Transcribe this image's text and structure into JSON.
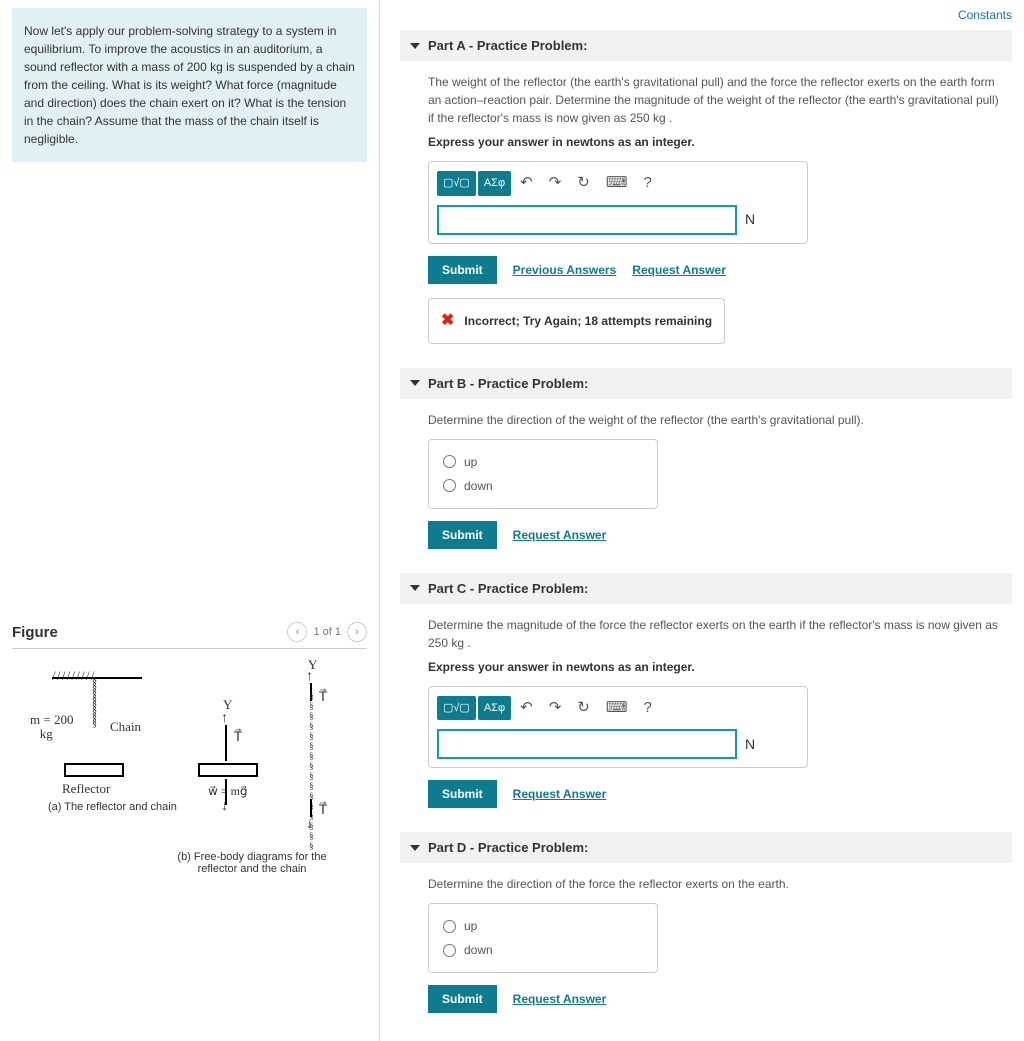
{
  "topLinks": {
    "constants": "Constants"
  },
  "problem": {
    "text": "Now let's apply our problem-solving strategy to a system in equilibrium. To improve the acoustics in an auditorium, a sound reflector with a mass of 200 kg is suspended by a chain from the ceiling. What is its weight? What force (magnitude and direction) does the chain exert on it? What is the tension in the chain? Assume that the mass of the chain itself is negligible."
  },
  "partA": {
    "title": "Part A - Practice Problem:",
    "desc": "The weight of the reflector (the earth's gravitational pull) and the force the reflector exerts on the earth form an action–reaction pair. Determine the magnitude of the weight of the reflector (the earth's gravitational pull) if the reflector's mass is now given as 250 kg .",
    "express": "Express your answer in newtons as an integer.",
    "unit": "N",
    "submit": "Submit",
    "prev": "Previous Answers",
    "req": "Request Answer",
    "feedback": "Incorrect; Try Again; 18 attempts remaining"
  },
  "partB": {
    "title": "Part B - Practice Problem:",
    "desc": "Determine the direction of the weight of the reflector (the earth's gravitational pull).",
    "opt1": "up",
    "opt2": "down",
    "submit": "Submit",
    "req": "Request Answer"
  },
  "partC": {
    "title": "Part C - Practice Problem:",
    "desc": "Determine the magnitude of the force the reflector exerts on the earth if the reflector's mass is now given as 250 kg .",
    "express": "Express your answer in newtons as an integer.",
    "unit": "N",
    "submit": "Submit",
    "req": "Request Answer"
  },
  "partD": {
    "title": "Part D - Practice Problem:",
    "desc": "Determine the direction of the force the reflector exerts on the earth.",
    "opt1": "up",
    "opt2": "down",
    "submit": "Submit",
    "req": "Request Answer"
  },
  "figure": {
    "title": "Figure",
    "page": "1 of 1",
    "massLabel": "m = 200",
    "kg": "kg",
    "chain": "Chain",
    "reflector": "Reflector",
    "capA": "(a) The reflector and chain",
    "capB": "(b) Free-body diagrams for the reflector and the chain",
    "T": "T",
    "w": "w = mg",
    "Y": "Y"
  },
  "toolbar": {
    "mathBtn": "▢√▢",
    "greekBtn": "ΑΣφ",
    "help": "?"
  }
}
